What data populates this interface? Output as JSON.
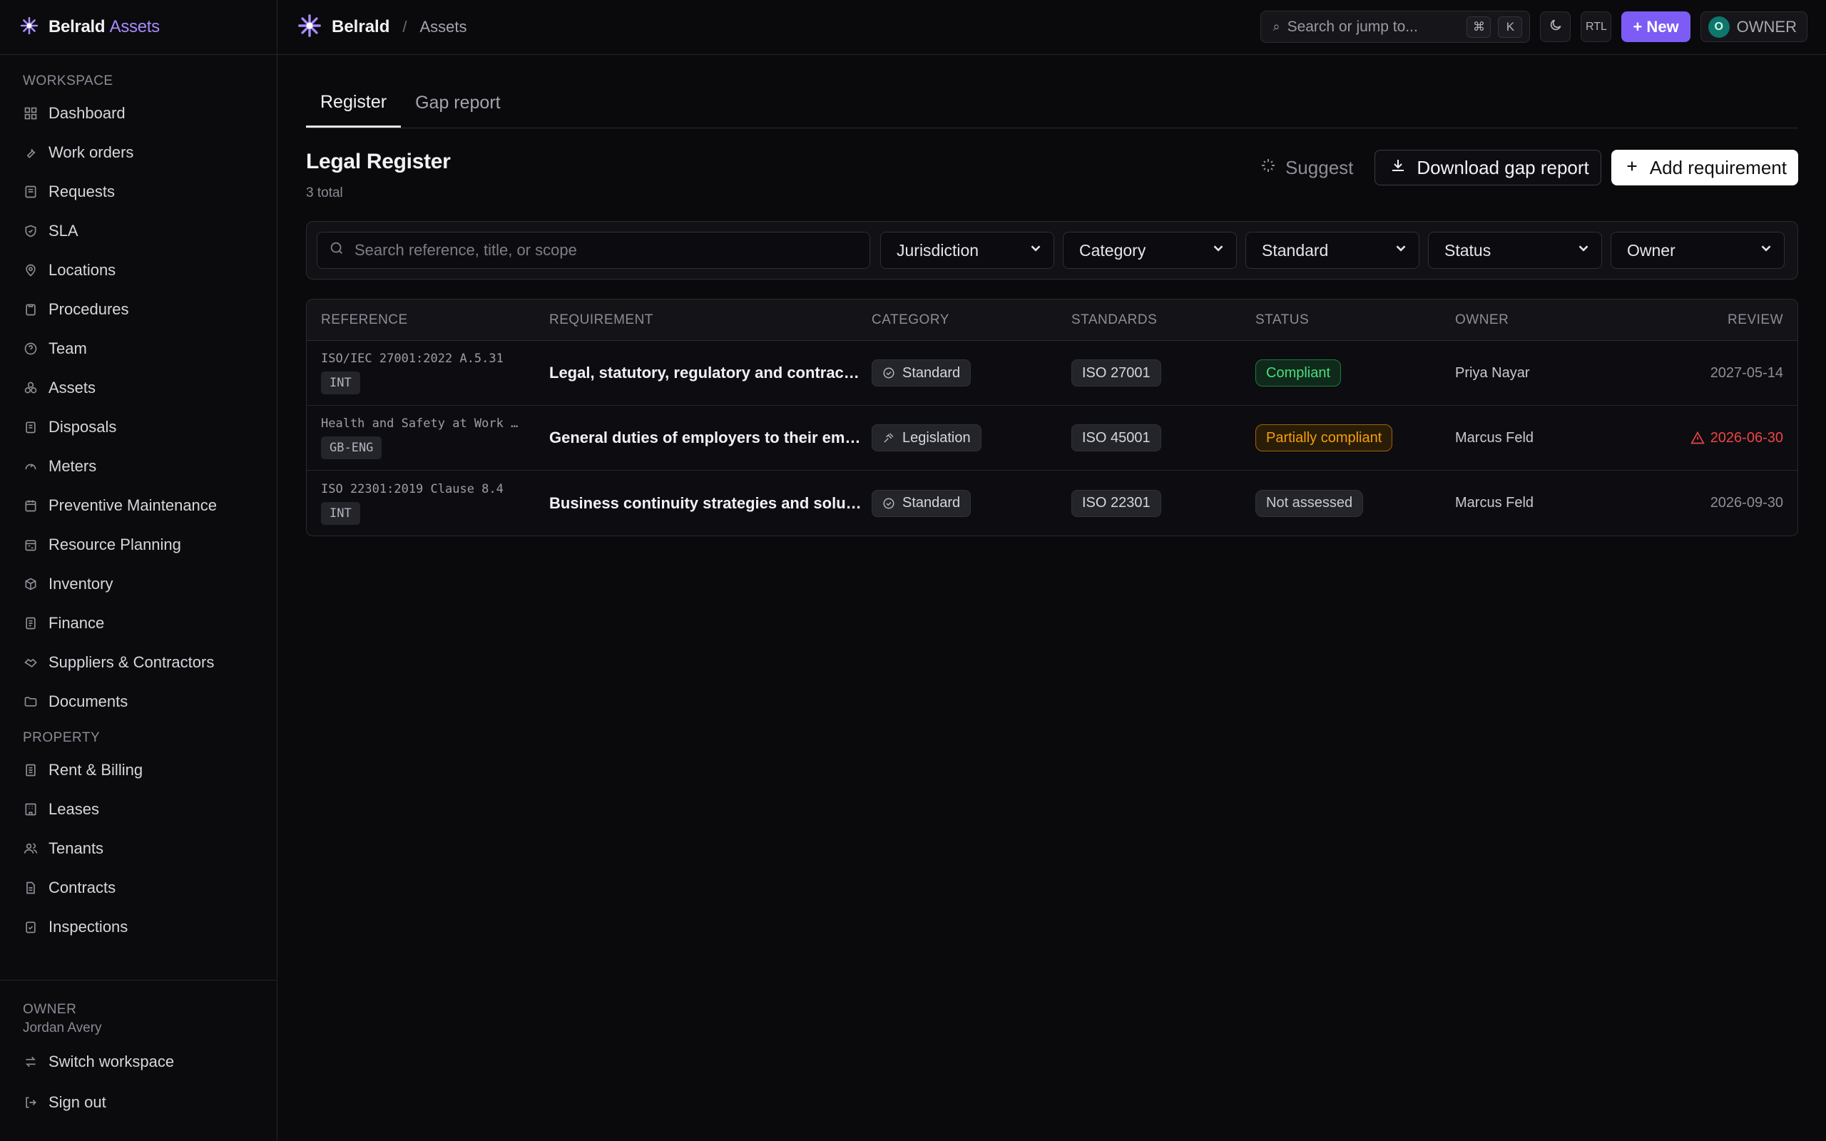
{
  "app": {
    "brand": "Belrald",
    "product": "Assets"
  },
  "breadcrumb": {
    "org": "Belrald",
    "page": "Assets"
  },
  "topbar": {
    "search_placeholder": "Search or jump to...",
    "kbd_cmd": "⌘",
    "kbd_k": "K",
    "rtl_label": "RTL",
    "new_label": "+ New",
    "avatar_initial": "O",
    "role_label": "OWNER"
  },
  "sidebar": {
    "workspace_label": "WORKSPACE",
    "workspace_items": [
      {
        "label": "Dashboard",
        "icon": "grid-icon"
      },
      {
        "label": "Work orders",
        "icon": "wrench-icon"
      },
      {
        "label": "Requests",
        "icon": "inbox-icon"
      },
      {
        "label": "SLA",
        "icon": "shield-check-icon"
      },
      {
        "label": "Locations",
        "icon": "map-pin-icon"
      },
      {
        "label": "Procedures",
        "icon": "clipboard-icon"
      },
      {
        "label": "Team",
        "icon": "help-circle-icon"
      },
      {
        "label": "Assets",
        "icon": "boxes-icon"
      },
      {
        "label": "Disposals",
        "icon": "recycle-icon"
      },
      {
        "label": "Meters",
        "icon": "gauge-icon"
      },
      {
        "label": "Preventive Maintenance",
        "icon": "calendar-icon"
      },
      {
        "label": "Resource Planning",
        "icon": "calendar-range-icon"
      },
      {
        "label": "Inventory",
        "icon": "package-icon"
      },
      {
        "label": "Finance",
        "icon": "file-icon"
      },
      {
        "label": "Suppliers & Contractors",
        "icon": "handshake-icon"
      },
      {
        "label": "Documents",
        "icon": "folder-icon"
      }
    ],
    "property_label": "PROPERTY",
    "property_items": [
      {
        "label": "Rent & Billing",
        "icon": "receipt-icon"
      },
      {
        "label": "Leases",
        "icon": "building-icon"
      },
      {
        "label": "Tenants",
        "icon": "users-icon"
      },
      {
        "label": "Contracts",
        "icon": "file-text-icon"
      },
      {
        "label": "Inspections",
        "icon": "clipboard-check-icon"
      }
    ],
    "footer": {
      "role": "OWNER",
      "user": "Jordan Avery",
      "switch_label": "Switch workspace",
      "signout_label": "Sign out"
    }
  },
  "tabs": [
    {
      "label": "Register",
      "active": true
    },
    {
      "label": "Gap report",
      "active": false
    }
  ],
  "header": {
    "title": "Legal Register",
    "subtitle": "3 total",
    "suggest_label": "Suggest",
    "download_label": "Download gap report",
    "add_label": "Add requirement"
  },
  "filters": {
    "search_placeholder": "Search reference, title, or scope",
    "selects": [
      "Jurisdiction",
      "Category",
      "Standard",
      "Status",
      "Owner"
    ]
  },
  "table": {
    "columns": [
      "REFERENCE",
      "REQUIREMENT",
      "CATEGORY",
      "STANDARDS",
      "STATUS",
      "OWNER",
      "REVIEW"
    ],
    "rows": [
      {
        "reference": "ISO/IEC 27001:2022 A.5.31",
        "jurisdiction": "INT",
        "requirement": "Legal, statutory, regulatory and contractu...",
        "category": "Standard",
        "category_icon": "check-circle-icon",
        "standard": "ISO 27001",
        "status": "Compliant",
        "status_kind": "ok",
        "owner": "Priya Nayar",
        "review": "2027-05-14",
        "overdue": false
      },
      {
        "reference": "Health and Safety at Work …",
        "jurisdiction": "GB-ENG",
        "requirement": "General duties of employers to their empl...",
        "category": "Legislation",
        "category_icon": "gavel-icon",
        "standard": "ISO 45001",
        "status": "Partially compliant",
        "status_kind": "partial",
        "owner": "Marcus Feld",
        "review": "2026-06-30",
        "overdue": true
      },
      {
        "reference": "ISO 22301:2019 Clause 8.4",
        "jurisdiction": "INT",
        "requirement": "Business continuity strategies and solutions",
        "category": "Standard",
        "category_icon": "check-circle-icon",
        "standard": "ISO 22301",
        "status": "Not assessed",
        "status_kind": "na",
        "owner": "Marcus Feld",
        "review": "2026-09-30",
        "overdue": false
      }
    ]
  },
  "colors": {
    "accent": "#7c5cf5",
    "brand_accent": "#a78bfa",
    "compliant": "#4ade80",
    "partial": "#f59e0b",
    "overdue": "#ef4444"
  }
}
